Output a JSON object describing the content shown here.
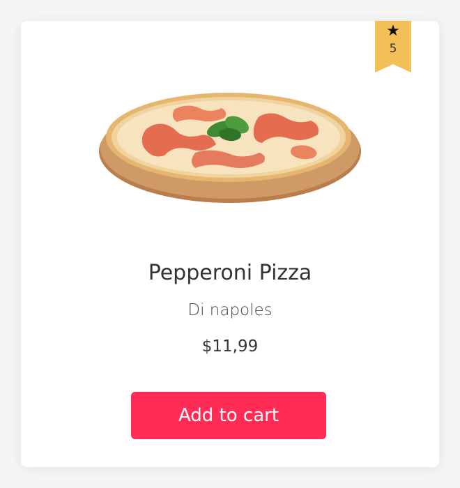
{
  "product": {
    "name": "Pepperoni Pizza",
    "subtitle": "Di napoles",
    "price": "$11,99",
    "rating": "5",
    "rating_icon": "★",
    "image_icon": "pizza-image"
  },
  "actions": {
    "add_to_cart_label": "Add to cart"
  },
  "colors": {
    "button": "#ff2d55",
    "badge": "#f3bf57",
    "card_background": "#ffffff",
    "page_background": "#f5f5f5"
  }
}
